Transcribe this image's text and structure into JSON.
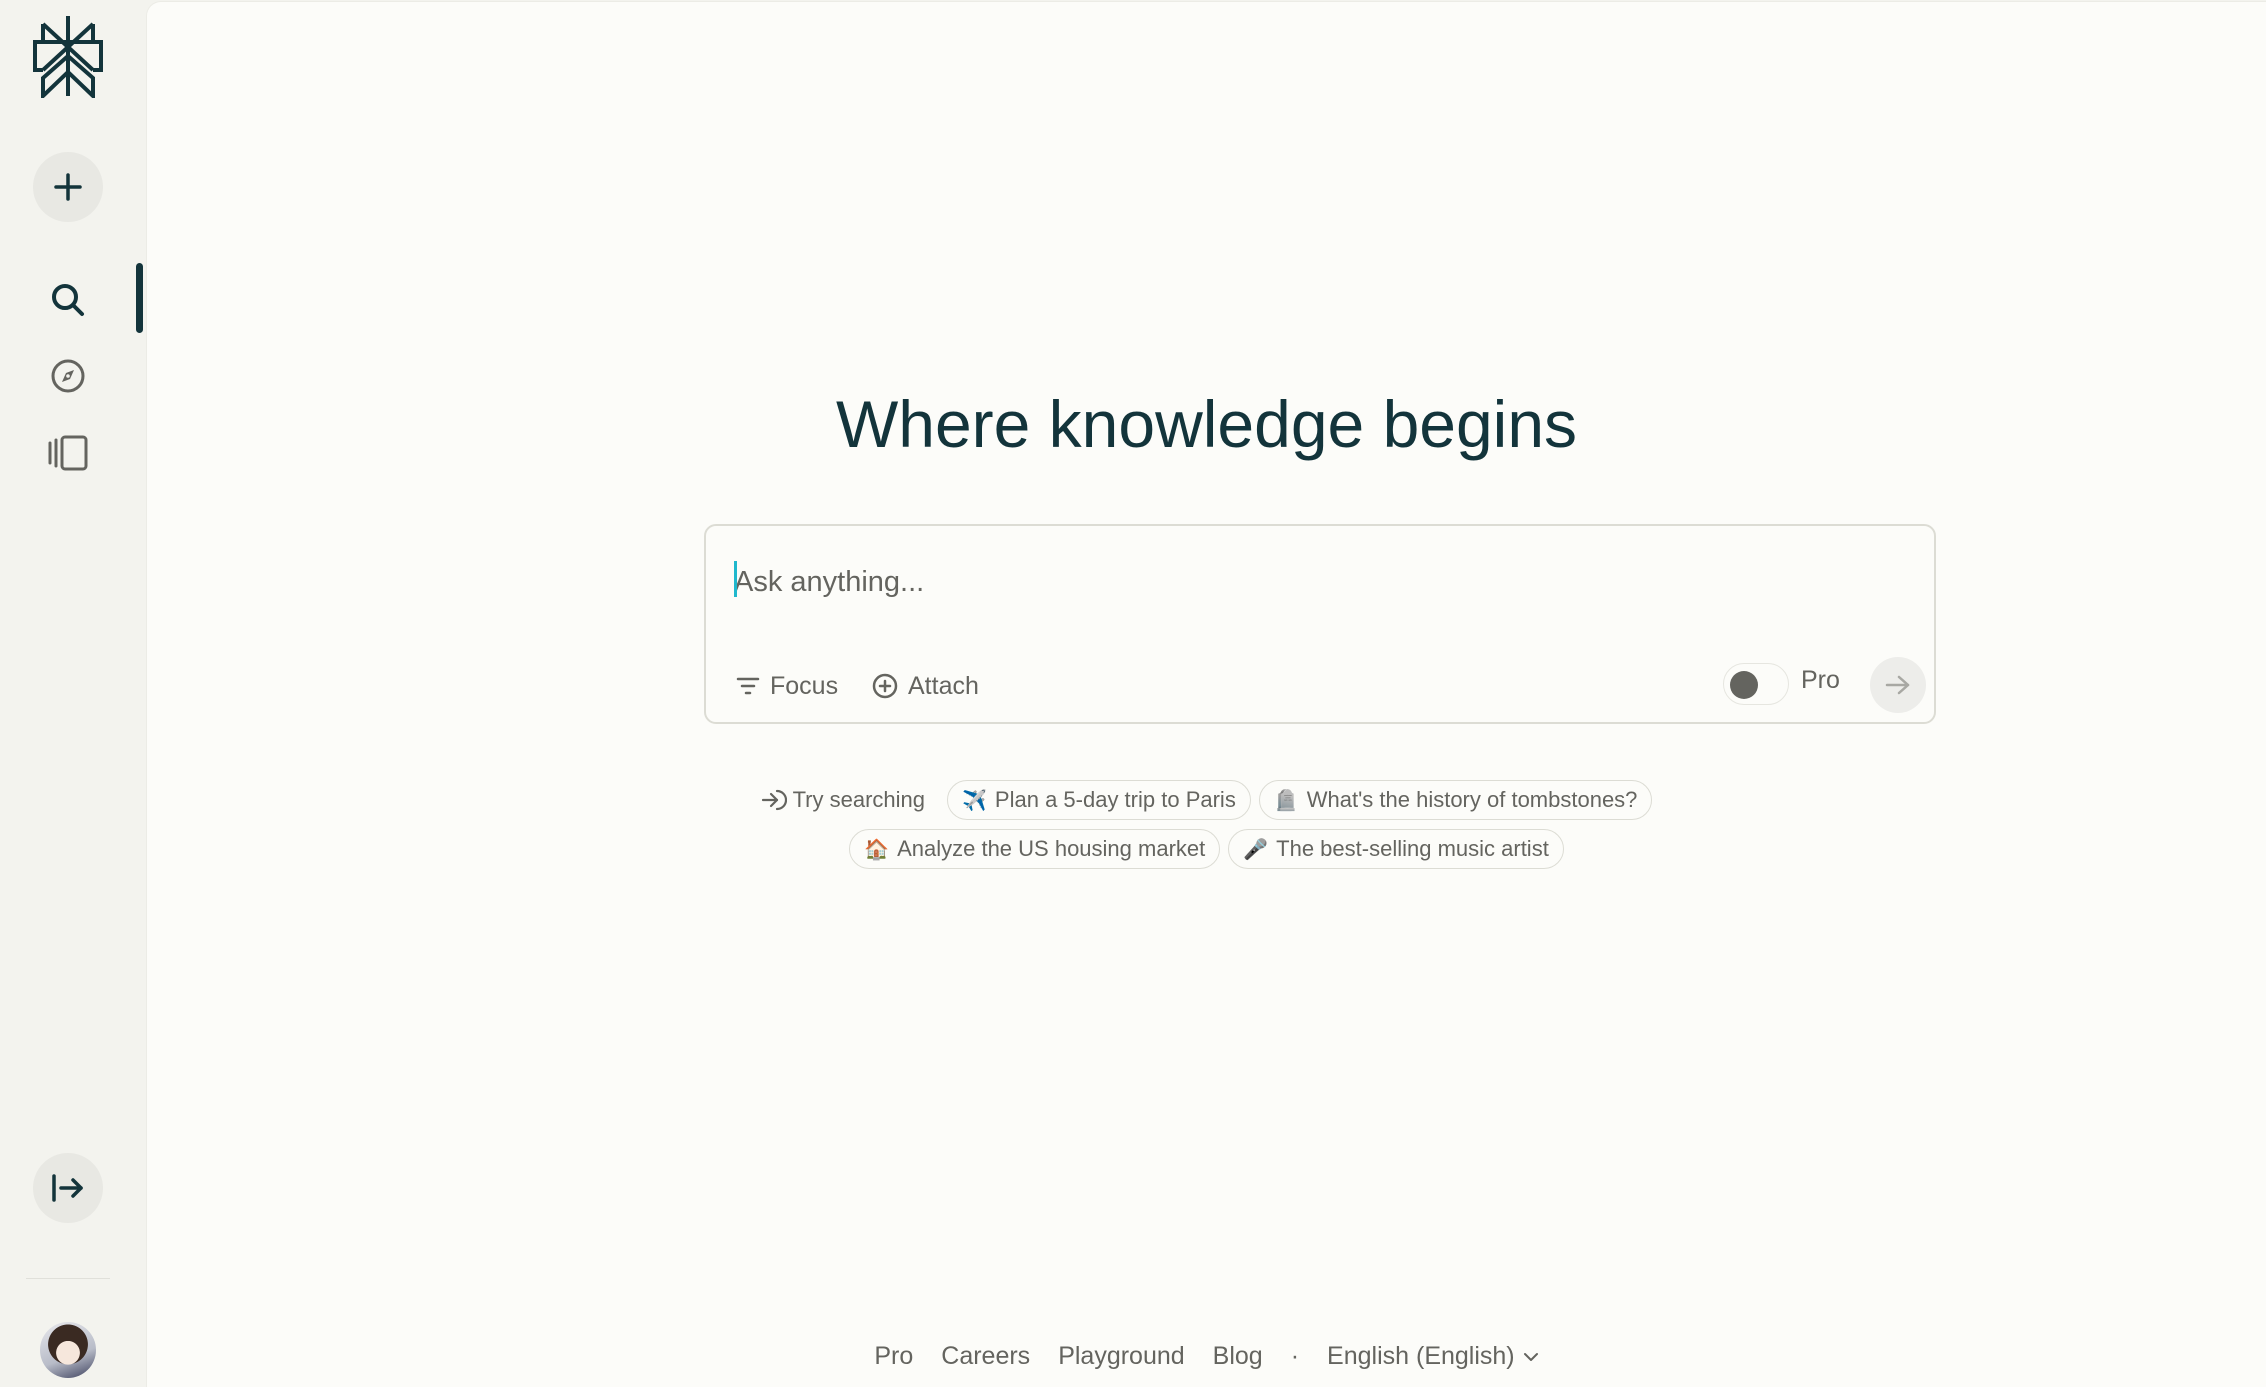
{
  "sidebar": {
    "logo": "perplexity-logo",
    "new_thread_icon": "plus-icon",
    "nav": [
      {
        "name": "search",
        "icon": "search-icon",
        "active": true
      },
      {
        "name": "discover",
        "icon": "compass-icon",
        "active": false
      },
      {
        "name": "library",
        "icon": "library-icon",
        "active": false
      }
    ],
    "expand_icon": "expand-sidebar-icon",
    "avatar": "user-avatar"
  },
  "main": {
    "headline": "Where knowledge begins",
    "ask": {
      "placeholder": "Ask anything...",
      "value": "",
      "focus_label": "Focus",
      "attach_label": "Attach",
      "pro_label": "Pro",
      "pro_enabled": false
    },
    "suggestions": {
      "try_label": "Try searching",
      "items": [
        {
          "emoji": "✈️",
          "label": "Plan a 5-day trip to Paris"
        },
        {
          "emoji": "🪦",
          "label": "What's the history of tombstones?"
        },
        {
          "emoji": "🏠",
          "label": "Analyze the US housing market"
        },
        {
          "emoji": "🎤",
          "label": "The best-selling music artist"
        }
      ]
    }
  },
  "footer": {
    "links": [
      "Pro",
      "Careers",
      "Playground",
      "Blog"
    ],
    "separator": "·",
    "language": "English (English)"
  },
  "colors": {
    "brand": "#13343b",
    "accent_caret": "#20b8cd",
    "muted_text": "#64645f",
    "background": "#fcfcf9",
    "sidebar_bg": "#f3f3ee"
  }
}
